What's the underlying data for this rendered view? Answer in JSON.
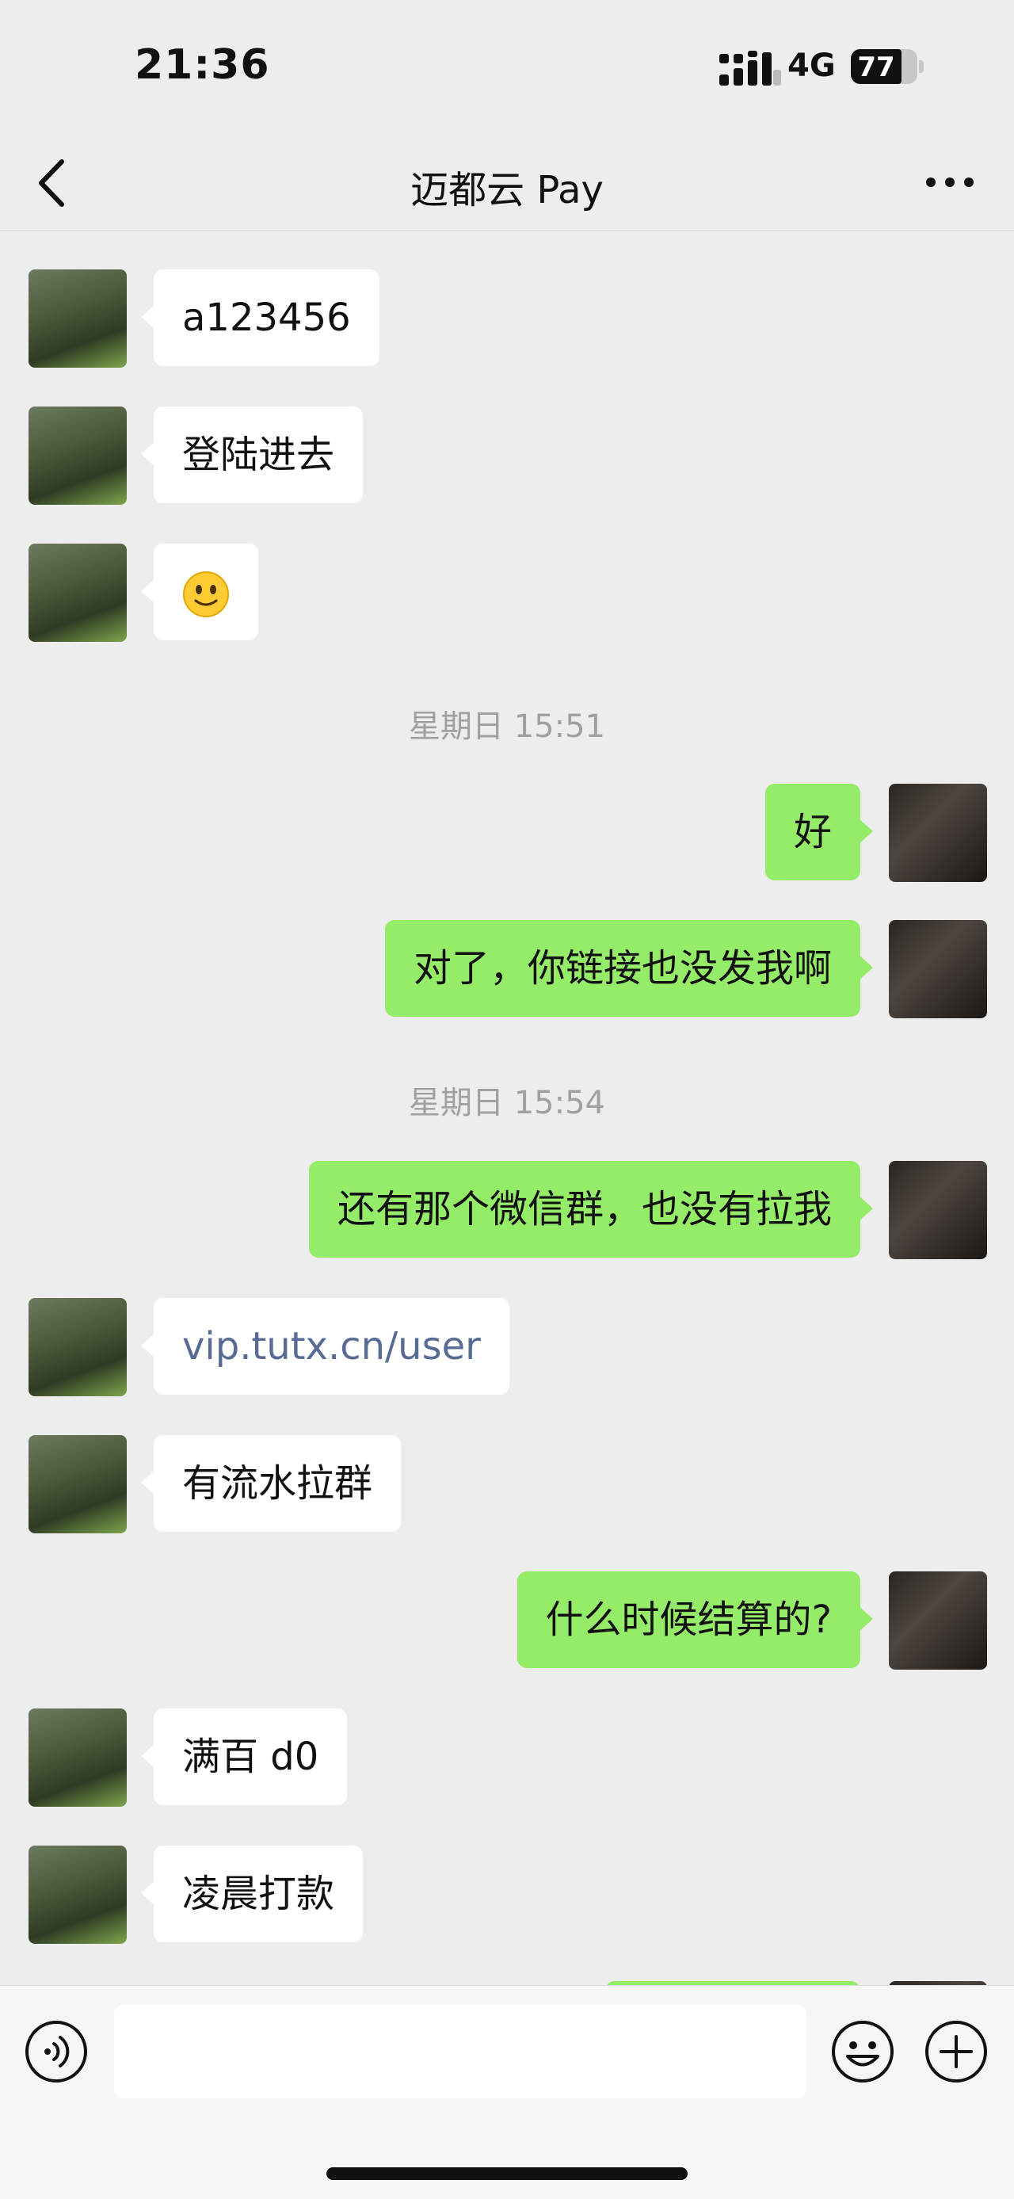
{
  "status_bar": {
    "time": "21:36",
    "network": "4G",
    "battery": "77"
  },
  "nav": {
    "title": "迈都云 Pay"
  },
  "messages": [
    {
      "side": "left",
      "text": "a123456"
    },
    {
      "side": "left",
      "text": "登陆进去"
    },
    {
      "side": "left",
      "emoji": "slightly-smiling-face"
    },
    {
      "timestamp": "星期日 15:51"
    },
    {
      "side": "right",
      "text": "好"
    },
    {
      "side": "right",
      "text": "对了，你链接也没发我啊"
    },
    {
      "timestamp": "星期日 15:54"
    },
    {
      "side": "right",
      "text": "还有那个微信群，也没有拉我"
    },
    {
      "side": "left",
      "text": "vip.tutx.cn/user",
      "is_link": true
    },
    {
      "side": "left",
      "text": "有流水拉群"
    },
    {
      "side": "right",
      "text": "什么时候结算的?"
    },
    {
      "side": "left",
      "text": "满百 d0"
    },
    {
      "side": "left",
      "text": "凌晨打款"
    }
  ],
  "input_bar": {
    "text_value": "",
    "icons": [
      "voice-icon",
      "emoji-icon",
      "plus-icon"
    ]
  },
  "colors": {
    "sent_bubble": "#95ec69",
    "received_bubble": "#ffffff",
    "link": "#576b95",
    "background": "#ededed"
  }
}
